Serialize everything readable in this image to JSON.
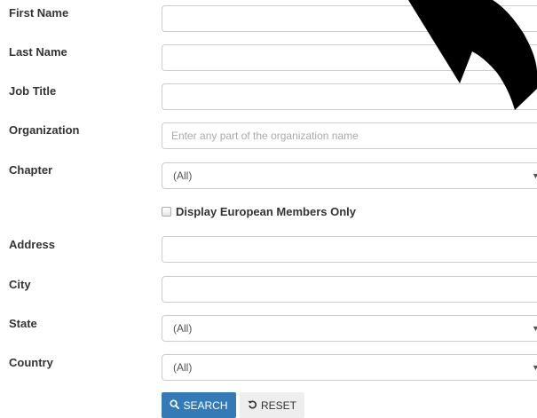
{
  "form": {
    "first_name": {
      "label": "First Name",
      "value": ""
    },
    "last_name": {
      "label": "Last Name",
      "value": ""
    },
    "job_title": {
      "label": "Job Title",
      "value": ""
    },
    "organization": {
      "label": "Organization",
      "value": "",
      "placeholder": "Enter any part of the organization name"
    },
    "chapter": {
      "label": "Chapter",
      "selected": "(All)"
    },
    "european_only": {
      "label": "Display European Members Only",
      "checked": false
    },
    "address": {
      "label": "Address",
      "value": ""
    },
    "city": {
      "label": "City",
      "value": ""
    },
    "state": {
      "label": "State",
      "selected": "(All)"
    },
    "country": {
      "label": "Country",
      "selected": "(All)"
    }
  },
  "buttons": {
    "search_label": "SEARCH",
    "reset_label": "RESET"
  },
  "icons": {
    "search": "magnifier-icon",
    "reset": "undo-icon",
    "caret": "caret-down-icon"
  },
  "colors": {
    "primary": "#337ab7",
    "secondary": "#eeeeee",
    "border": "#cccccc",
    "annotation": "#000000"
  }
}
